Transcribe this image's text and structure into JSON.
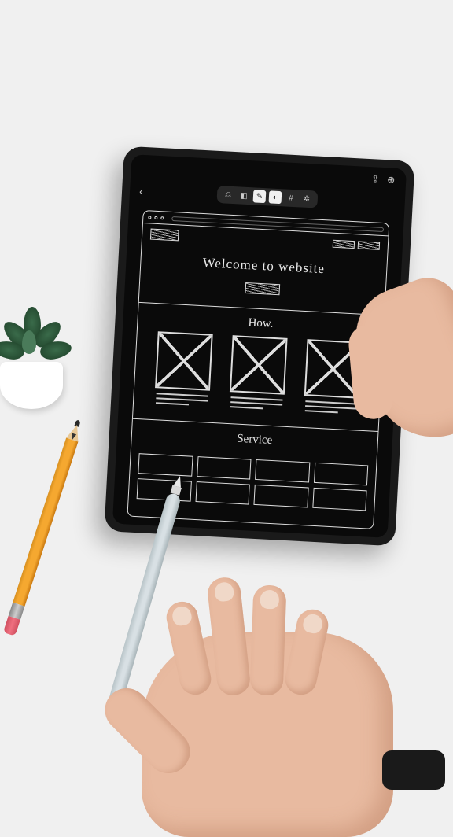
{
  "wireframe": {
    "hero_text": "Welcome to website",
    "section_how": "How.",
    "section_service": "Service"
  }
}
